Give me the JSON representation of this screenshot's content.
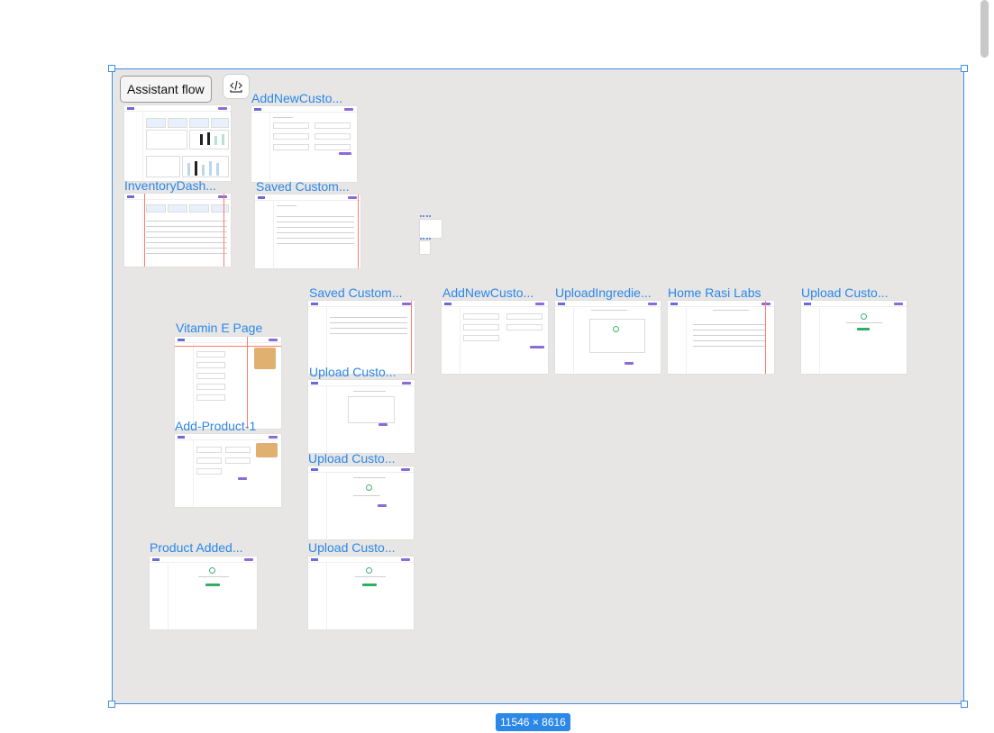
{
  "toolbar": {
    "tooltip_label": "Assistant flow",
    "dev_mode_icon": "code-brackets-icon"
  },
  "canvas": {
    "dimensions_label": "11546 × 8616"
  },
  "frames": [
    {
      "label": "AddNewCusto...",
      "preview": "form"
    },
    {
      "label": "InventoryDash...",
      "preview": "table"
    },
    {
      "label": "Saved Custom...",
      "preview": "table"
    },
    {
      "label": "Saved Custom...",
      "preview": "table"
    },
    {
      "label": "AddNewCusto...",
      "preview": "form"
    },
    {
      "label": "UploadIngredie...",
      "preview": "upload"
    },
    {
      "label": "Home Rasi Labs",
      "preview": "table"
    },
    {
      "label": "Upload Custo...",
      "preview": "success"
    },
    {
      "label": "Vitamin E Page",
      "preview": "product"
    },
    {
      "label": "Upload Custo...",
      "preview": "upload"
    },
    {
      "label": "Add-Product-1",
      "preview": "product"
    },
    {
      "label": "Upload Custo...",
      "preview": "upload"
    },
    {
      "label": "Product Added...",
      "preview": "success"
    },
    {
      "label": "Upload Custo...",
      "preview": "success"
    }
  ],
  "colors": {
    "selection": "#2b87e8",
    "canvas_bg": "#e7e6e5",
    "accent": "#8a6bd8",
    "success": "#2fae5e",
    "grid_red": "#ff7b6b"
  }
}
